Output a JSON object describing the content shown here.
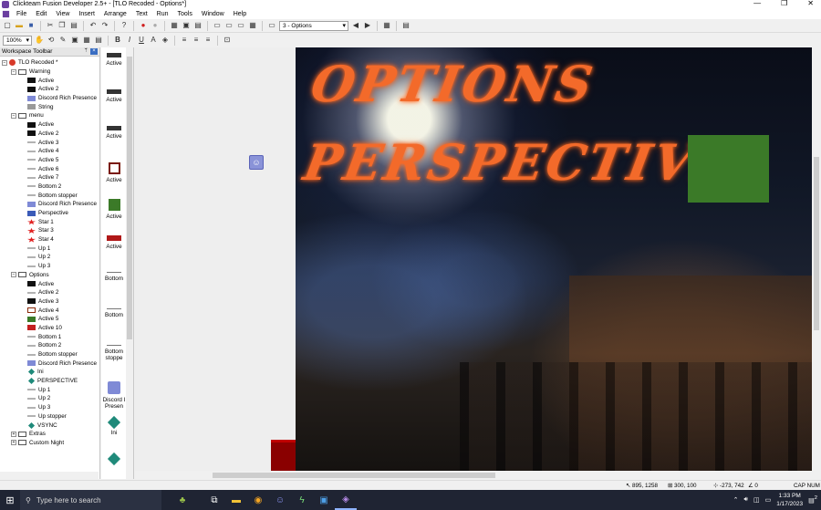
{
  "window": {
    "title": "Clickteam Fusion Developer 2.5+ - [TLO Recoded - Options*]",
    "controls": [
      "—",
      "❐",
      "✕"
    ]
  },
  "menubar": {
    "items": [
      "File",
      "Edit",
      "View",
      "Insert",
      "Arrange",
      "Text",
      "Run",
      "Tools",
      "Window",
      "Help"
    ]
  },
  "toolbar": {
    "frame_select_value": "3 - Options",
    "zoom_value": "100%"
  },
  "workspace": {
    "title": "Workspace Toolbar",
    "tree": [
      {
        "label": "TLO Recoded *",
        "level": 0,
        "expander": "−",
        "icon": "app-icon"
      },
      {
        "label": "Warning",
        "level": 1,
        "expander": "−",
        "icon": "frame-icon"
      },
      {
        "label": "Active",
        "level": 2,
        "icon": "active-icon"
      },
      {
        "label": "Active 2",
        "level": 2,
        "icon": "active-icon"
      },
      {
        "label": "Discord Rich Presence",
        "level": 2,
        "icon": "discord-icon"
      },
      {
        "label": "String",
        "level": 2,
        "icon": "string-icon"
      },
      {
        "label": "menu",
        "level": 1,
        "expander": "−",
        "icon": "frame-icon"
      },
      {
        "label": "Active",
        "level": 2,
        "icon": "active-icon"
      },
      {
        "label": "Active 2",
        "level": 2,
        "icon": "active-icon"
      },
      {
        "label": "Active 3",
        "level": 2,
        "icon": "line-icon"
      },
      {
        "label": "Active 4",
        "level": 2,
        "icon": "line-icon"
      },
      {
        "label": "Active 5",
        "level": 2,
        "icon": "line-icon"
      },
      {
        "label": "Active 6",
        "level": 2,
        "icon": "line-icon"
      },
      {
        "label": "Active 7",
        "level": 2,
        "icon": "line-icon"
      },
      {
        "label": "Bottom 2",
        "level": 2,
        "icon": "line-icon"
      },
      {
        "label": "Bottom stopper",
        "level": 2,
        "icon": "line-icon"
      },
      {
        "label": "Discord Rich Presence",
        "level": 2,
        "icon": "discord-icon"
      },
      {
        "label": "Perspective",
        "level": 2,
        "icon": "perspective-icon"
      },
      {
        "label": "Star 1",
        "level": 2,
        "icon": "star-icon"
      },
      {
        "label": "Star 3",
        "level": 2,
        "icon": "star-icon"
      },
      {
        "label": "Star 4",
        "level": 2,
        "icon": "star-icon"
      },
      {
        "label": "Up 1",
        "level": 2,
        "icon": "line-icon"
      },
      {
        "label": "Up 2",
        "level": 2,
        "icon": "line-icon"
      },
      {
        "label": "Up 3",
        "level": 2,
        "icon": "line-icon"
      },
      {
        "label": "Options",
        "level": 1,
        "expander": "−",
        "icon": "frame-icon"
      },
      {
        "label": "Active",
        "level": 2,
        "icon": "active-icon"
      },
      {
        "label": "Active 2",
        "level": 2,
        "icon": "line-icon"
      },
      {
        "label": "Active 3",
        "level": 2,
        "icon": "active-icon"
      },
      {
        "label": "Active 4",
        "level": 2,
        "icon": "box-icon"
      },
      {
        "label": "Active 5",
        "level": 2,
        "icon": "green-icon"
      },
      {
        "label": "Active 10",
        "level": 2,
        "icon": "red-text-icon"
      },
      {
        "label": "Bottom 1",
        "level": 2,
        "icon": "line-icon"
      },
      {
        "label": "Bottom 2",
        "level": 2,
        "icon": "line-icon"
      },
      {
        "label": "Bottom stopper",
        "level": 2,
        "icon": "line-icon"
      },
      {
        "label": "Discord Rich Presence",
        "level": 2,
        "icon": "discord-icon"
      },
      {
        "label": "Ini",
        "level": 2,
        "icon": "ini-icon"
      },
      {
        "label": "PERSPECTIVE",
        "level": 2,
        "icon": "ini-icon"
      },
      {
        "label": "Up 1",
        "level": 2,
        "icon": "line-icon"
      },
      {
        "label": "Up 2",
        "level": 2,
        "icon": "line-icon"
      },
      {
        "label": "Up 3",
        "level": 2,
        "icon": "line-icon"
      },
      {
        "label": "Up stopper",
        "level": 2,
        "icon": "line-icon"
      },
      {
        "label": "VSYNC",
        "level": 2,
        "icon": "ini-icon"
      },
      {
        "label": "Extras",
        "level": 1,
        "expander": "+",
        "icon": "frame-icon"
      },
      {
        "label": "Custom Night",
        "level": 1,
        "expander": "+",
        "icon": "frame-icon"
      }
    ]
  },
  "object_panel": {
    "items": [
      {
        "label": "Active",
        "icon": "active-icon"
      },
      {
        "label": "Active",
        "icon": "active-icon"
      },
      {
        "label": "Active",
        "icon": "active-icon"
      },
      {
        "label": "Active",
        "icon": "box-icon"
      },
      {
        "label": "Active",
        "icon": "green-icon"
      },
      {
        "label": "Active",
        "icon": "red-text-icon"
      },
      {
        "label": "Bottom",
        "icon": "line-icon"
      },
      {
        "label": "Bottom",
        "icon": "line-icon"
      },
      {
        "label": "Bottom stoppe",
        "icon": "line-icon"
      },
      {
        "label": "Discord I Presen",
        "icon": "discord-icon"
      },
      {
        "label": "Ini",
        "icon": "ini-icon"
      },
      {
        "label": "",
        "icon": "ini-icon"
      }
    ]
  },
  "scene": {
    "title_line1": "OPTIONS",
    "title_line2": "PERSPECTIVE"
  },
  "statusbar": {
    "coords": "895, 1258",
    "size": "300, 100",
    "offset": "-273, 742",
    "angle": "0",
    "keys": "CAP NUM"
  },
  "taskbar": {
    "search_placeholder": "Type here to search",
    "time": "1:33 PM",
    "date": "1/17/2023",
    "notification_count": "2"
  }
}
